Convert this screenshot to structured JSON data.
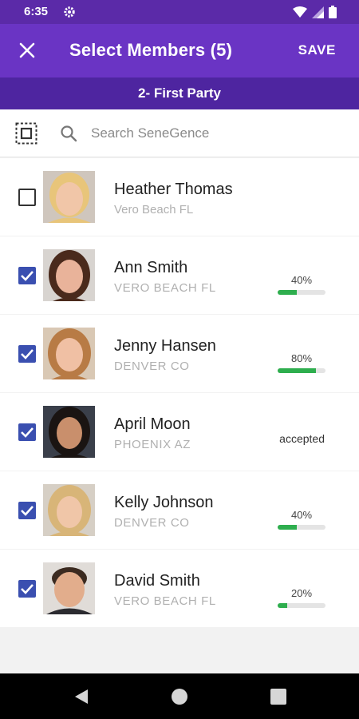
{
  "status_bar": {
    "time": "6:35",
    "icons": [
      "gear-icon",
      "wifi-icon",
      "signal-icon",
      "battery-icon"
    ]
  },
  "app_bar": {
    "close_icon": "close-icon",
    "title": "Select Members (5)",
    "save_label": "SAVE"
  },
  "sub_bar": {
    "title": "2- First Party"
  },
  "search": {
    "placeholder": "Search SeneGence",
    "select_all_icon": "select-all-icon",
    "icon": "search-icon"
  },
  "members": [
    {
      "name": "Heather Thomas",
      "location": "Vero Beach FL",
      "checked": false,
      "progress": null,
      "status": ""
    },
    {
      "name": "Ann Smith",
      "location": "VERO BEACH FL",
      "checked": true,
      "progress": 0.4,
      "progress_label": "40%",
      "status": ""
    },
    {
      "name": "Jenny Hansen",
      "location": "DENVER CO",
      "checked": true,
      "progress": 0.8,
      "progress_label": "80%",
      "status": ""
    },
    {
      "name": "April Moon",
      "location": "PHOENIX AZ",
      "checked": true,
      "progress": null,
      "status": "accepted"
    },
    {
      "name": "Kelly Johnson",
      "location": "DENVER CO",
      "checked": true,
      "progress": 0.4,
      "progress_label": "40%",
      "status": ""
    },
    {
      "name": "David Smith",
      "location": "VERO BEACH FL",
      "checked": true,
      "progress": 0.2,
      "progress_label": "20%",
      "status": ""
    }
  ],
  "colors": {
    "primary": "#6a34c4",
    "primary_dark": "#4e25a0",
    "checkbox": "#3a4fb0",
    "progress": "#2eae4e"
  },
  "nav_bar": {
    "icons": [
      "back-icon",
      "home-icon",
      "recents-icon"
    ]
  }
}
